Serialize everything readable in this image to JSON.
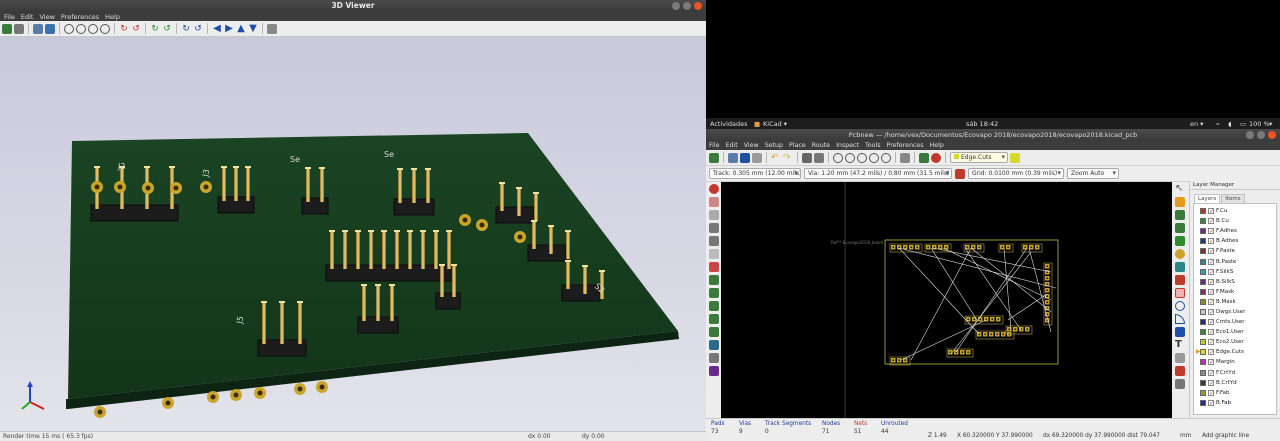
{
  "viewer3d": {
    "title": "3D Viewer",
    "menu": [
      "File",
      "Edit",
      "View",
      "Preferences",
      "Help"
    ],
    "status": {
      "render_time": "Render time 15 ms ( 65.3 fps)",
      "dx": "dx 0.00",
      "dy": "dy 0.00"
    },
    "labels": {
      "j3": "J3",
      "j2": "J2",
      "se": "Se",
      "s2": "S2",
      "j5": "J5"
    },
    "board_color": "#12331a"
  },
  "system_bar": {
    "activities": "Actividades",
    "app": "KiCad ▾",
    "clock": "sáb 18:42",
    "lang": "en ▾",
    "battery": "100 %"
  },
  "pcbnew": {
    "title": "Pcbnew — /home/vex/Documentos/Ecovapo 2018/ecovapo2018/ecovapo2018.kicad_pcb",
    "menu": [
      "File",
      "Edit",
      "View",
      "Setup",
      "Place",
      "Route",
      "Inspect",
      "Tools",
      "Preferences",
      "Help"
    ],
    "layer_select": "Edge.Cuts",
    "track": "Track: 0.305 mm (12.00 mils) *",
    "via": "Via: 1.20 mm (47.2 mils) / 0.80 mm (31.5 mils) *",
    "grid": "Grid: 0.0100 mm (0.39 mils)",
    "zoom": "Zoom Auto",
    "board_label": "Ref** Ecovapo2018_board",
    "layer_manager": {
      "title": "Layer Manager",
      "tabs": [
        "Layers",
        "Items"
      ],
      "layers": [
        {
          "name": "F.Cu",
          "color": "#b33a2e"
        },
        {
          "name": "B.Cu",
          "color": "#2d8a2d"
        },
        {
          "name": "F.Adhes",
          "color": "#7a2a7a"
        },
        {
          "name": "B.Adhes",
          "color": "#1d3d8a"
        },
        {
          "name": "F.Paste",
          "color": "#8a2a2a"
        },
        {
          "name": "B.Paste",
          "color": "#2a8a8a"
        },
        {
          "name": "F.SilkS",
          "color": "#2aa0a0"
        },
        {
          "name": "B.SilkS",
          "color": "#6a2a8a"
        },
        {
          "name": "F.Mask",
          "color": "#8a2a6a"
        },
        {
          "name": "B.Mask",
          "color": "#8a8a2a"
        },
        {
          "name": "Dwgs.User",
          "color": "#c8c8c8"
        },
        {
          "name": "Cmts.User",
          "color": "#2a2a8a"
        },
        {
          "name": "Eco1.User",
          "color": "#2a8a2a"
        },
        {
          "name": "Eco2.User",
          "color": "#c8c82a"
        },
        {
          "name": "Edge.Cuts",
          "color": "#d8d82a"
        },
        {
          "name": "Margin",
          "color": "#c82ac8"
        },
        {
          "name": "F.CrtYd",
          "color": "#8a8a8a"
        },
        {
          "name": "B.CrtYd",
          "color": "#3a3a3a"
        },
        {
          "name": "F.Fab",
          "color": "#9a9a2a"
        },
        {
          "name": "B.Fab",
          "color": "#2a2a9a"
        }
      ],
      "active_layer": "Edge.Cuts"
    },
    "status": {
      "pads_label": "Pads",
      "pads": "73",
      "vias_label": "Vias",
      "vias": "9",
      "segments_label": "Track Segments",
      "segments": "0",
      "nodes_label": "Nodes",
      "nodes": "71",
      "nets_label": "Nets",
      "nets": "51",
      "unrouted_label": "Unrouted",
      "unrouted": "44",
      "zoom": "Z 1.49",
      "xy": "X 60.320000  Y 37.990000",
      "dxy": "dx 69.320000  dy 37.990000  dist 79.047",
      "units": "mm",
      "mode": "Add graphic line"
    }
  }
}
